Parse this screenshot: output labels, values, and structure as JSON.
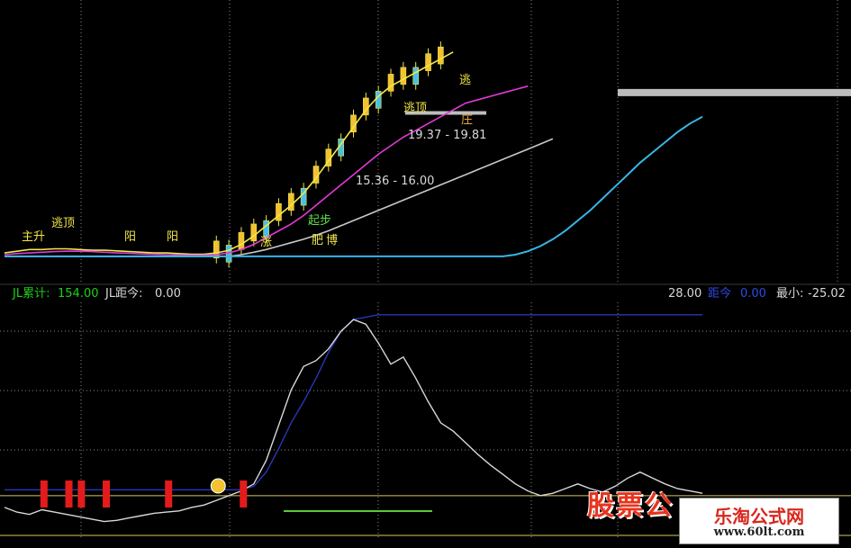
{
  "top_panel": {
    "band_labels": [
      "19.37 - 19.81",
      "15.36 - 16.00"
    ],
    "signals": [
      "逃顶",
      "逃顶",
      "逃",
      "主升",
      "阳",
      "阳",
      "起步",
      "涨",
      "庄",
      "肥",
      "博"
    ]
  },
  "status_bar": {
    "jl_total_label": "JL累计:",
    "jl_total_value": "154.00",
    "jl_dist_label": "JL距今:",
    "jl_dist_value": "0.00",
    "right_value": "28.00",
    "dist_label": "距今",
    "dist_value": "0.00",
    "min_label": "最小:",
    "min_value": "-25.02"
  },
  "watermark": {
    "stock_text": "股票公",
    "site_name": "乐淘公式网",
    "site_url": "www.60lt.com"
  },
  "colors": {
    "background": "#000000",
    "price_line_yellow": "#f2e64a",
    "ma_magenta": "#e23ad6",
    "ma_white": "#c8c8c8",
    "ma_cyan": "#3ab4e6",
    "indicator_blue": "#2836b8",
    "indicator_white": "#d8d8d8",
    "band_grey": "#bdbdbd",
    "signal_bar_red": "#e41b1b",
    "status_green": "#1ad11a",
    "status_pink": "#ff4ad0",
    "grid_dotted": "#8a8a8a"
  },
  "chart_data": [
    {
      "type": "line",
      "panel": "price",
      "x": [
        0,
        1,
        2,
        3,
        4,
        5,
        6,
        7,
        8,
        9,
        10,
        11,
        12,
        13,
        14,
        15,
        16,
        17,
        18,
        19,
        20,
        21,
        22,
        23,
        24,
        25,
        26,
        27,
        28,
        29,
        30,
        31,
        32,
        33,
        34,
        35,
        36,
        37,
        38,
        39,
        40,
        41,
        42,
        43,
        44,
        45,
        46,
        47,
        48,
        49,
        50,
        51,
        52,
        53,
        54,
        55,
        56
      ],
      "series": [
        {
          "values": [
            15.1,
            15.15,
            15.2,
            15.2,
            15.22,
            15.22,
            15.2,
            15.18,
            15.18,
            15.16,
            15.14,
            15.12,
            15.1,
            15.1,
            15.08,
            15.06,
            15.06,
            15.1,
            15.18,
            15.35,
            15.6,
            15.9,
            16.2,
            16.5,
            16.85,
            17.3,
            17.8,
            18.3,
            18.8,
            19.3,
            19.7,
            20.0,
            20.2,
            20.4,
            20.6,
            20.8,
            21.0,
            21.0,
            21.0,
            21.0,
            21.0,
            21.0,
            21.0,
            21.0,
            21.0,
            21.0,
            21.0,
            21.0,
            21.0,
            21.0,
            21.0,
            21.0,
            21.0,
            21.0,
            21.0,
            21.0,
            21.0
          ]
        },
        {
          "values": [
            15.05,
            15.08,
            15.1,
            15.12,
            15.14,
            15.15,
            15.15,
            15.14,
            15.12,
            15.1,
            15.09,
            15.07,
            15.06,
            15.05,
            15.04,
            15.03,
            15.03,
            15.05,
            15.1,
            15.2,
            15.35,
            15.55,
            15.75,
            15.95,
            16.2,
            16.5,
            16.8,
            17.1,
            17.4,
            17.7,
            18.0,
            18.25,
            18.5,
            18.7,
            18.9,
            19.1,
            19.3,
            19.5,
            19.6,
            19.7,
            19.8,
            19.9,
            20.0,
            20.0,
            20.0,
            20.0,
            20.0,
            20.0,
            20.0,
            20.0,
            20.0,
            20.0,
            20.0,
            20.0,
            20.0,
            20.0,
            20.0
          ]
        },
        {
          "values": [
            15.0,
            15.0,
            15.0,
            15.0,
            15.0,
            15.0,
            15.0,
            15.0,
            15.0,
            15.0,
            15.0,
            15.0,
            15.0,
            15.0,
            15.0,
            15.0,
            15.0,
            15.0,
            15.0,
            15.05,
            15.12,
            15.2,
            15.3,
            15.4,
            15.5,
            15.62,
            15.75,
            15.9,
            16.05,
            16.2,
            16.35,
            16.5,
            16.65,
            16.8,
            16.95,
            17.1,
            17.25,
            17.4,
            17.55,
            17.7,
            17.85,
            18.0,
            18.15,
            18.3,
            18.45,
            18.6,
            18.75,
            18.9,
            19.05,
            19.2,
            19.35,
            19.45,
            19.55,
            19.6,
            19.65,
            19.7,
            19.75
          ]
        },
        {
          "values": [
            15.0,
            15.0,
            15.0,
            15.0,
            15.0,
            15.0,
            15.0,
            15.0,
            15.0,
            15.0,
            15.0,
            15.0,
            15.0,
            15.0,
            15.0,
            15.0,
            15.0,
            15.0,
            15.0,
            15.0,
            15.0,
            15.0,
            15.0,
            15.0,
            15.0,
            15.0,
            15.0,
            15.0,
            15.0,
            15.0,
            15.0,
            15.0,
            15.0,
            15.0,
            15.0,
            15.0,
            15.0,
            15.0,
            15.0,
            15.0,
            15.0,
            15.05,
            15.15,
            15.3,
            15.5,
            15.75,
            16.05,
            16.35,
            16.7,
            17.05,
            17.4,
            17.75,
            18.05,
            18.35,
            18.65,
            18.9,
            19.1
          ]
        }
      ],
      "bands": [
        19.37,
        19.81,
        15.36,
        16.0
      ],
      "ylim": [
        14.6,
        22.0
      ]
    },
    {
      "type": "line",
      "panel": "indicator",
      "x": [
        0,
        1,
        2,
        3,
        4,
        5,
        6,
        7,
        8,
        9,
        10,
        11,
        12,
        13,
        14,
        15,
        16,
        17,
        18,
        19,
        20,
        21,
        22,
        23,
        24,
        25,
        26,
        27,
        28,
        29,
        30,
        31,
        32,
        33,
        34,
        35,
        36,
        37,
        38,
        39,
        40,
        41,
        42,
        43,
        44,
        45,
        46,
        47,
        48,
        49,
        50,
        51,
        52,
        53,
        54,
        55,
        56
      ],
      "series": [
        {
          "values": [
            5,
            5,
            5,
            5,
            5,
            5,
            5,
            5,
            5,
            5,
            5,
            5,
            5,
            5,
            5,
            5,
            5,
            5,
            5,
            5,
            8,
            20,
            40,
            62,
            80,
            100,
            122,
            140,
            150,
            152,
            154,
            154,
            154,
            154,
            154,
            154,
            154,
            154,
            154,
            154,
            154,
            154,
            154,
            154,
            154,
            154,
            154,
            154,
            154,
            154,
            154,
            154,
            154,
            154,
            154,
            154,
            154
          ]
        },
        {
          "values": [
            -10,
            -14,
            -16,
            -12,
            -14,
            -16,
            -18,
            -20,
            -22,
            -21,
            -19,
            -17,
            -15,
            -14,
            -13,
            -10,
            -8,
            -4,
            0,
            4,
            10,
            30,
            60,
            90,
            110,
            115,
            125,
            140,
            150,
            146,
            130,
            112,
            118,
            100,
            80,
            62,
            55,
            45,
            35,
            26,
            18,
            10,
            4,
            0,
            2,
            6,
            10,
            6,
            3,
            8,
            15,
            20,
            15,
            10,
            6,
            4,
            2
          ]
        }
      ],
      "ylim": [
        -30,
        160
      ]
    }
  ]
}
